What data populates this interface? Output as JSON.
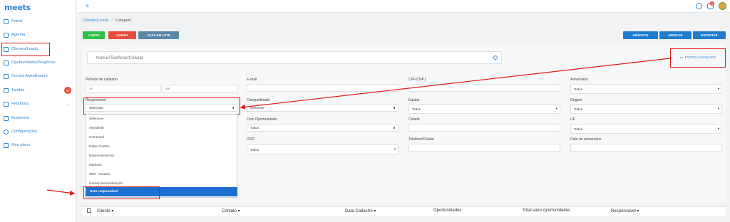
{
  "app": {
    "logo": "meets"
  },
  "sidebar": {
    "items": [
      {
        "label": "Painel"
      },
      {
        "label": "Agenda"
      },
      {
        "label": "Clientes/Leads"
      },
      {
        "label": "Oportunidades/Negócios"
      },
      {
        "label": "Central Atendimento"
      },
      {
        "label": "Tarefas",
        "badge": "47"
      },
      {
        "label": "Relatórios"
      },
      {
        "label": "Academia"
      },
      {
        "label": "Configurações"
      },
      {
        "label": "Meu plano"
      }
    ]
  },
  "topbar": {
    "notif_count": "5"
  },
  "breadcrumb": {
    "parent": "Clientes/Leads",
    "current": "Listagem"
  },
  "toolbar": {
    "novo": "+ NOVO",
    "lixeira": "LIXEIRA",
    "acao_lote": "AÇÃO EM LOTE",
    "graficos": "GRÁFICOS",
    "unificar": "UNIFICAR",
    "exportar": "EXPORTAR"
  },
  "search": {
    "placeholder": "Nome/Telefone/Celular"
  },
  "filtro_avancado": "FILTRO AVANÇADO",
  "filters": {
    "periodo_cadastro": {
      "label": "Período de cadastro",
      "de": "de",
      "ate": "até"
    },
    "responsavel": {
      "label": "Responsável",
      "value": "Selecione"
    },
    "email": {
      "label": "E-mail"
    },
    "compartilhado": {
      "label": "Compartilhado",
      "value": "Selecione"
    },
    "com_oportunidade": {
      "label": "Com Oportunidade",
      "value": "Todos"
    },
    "ddd": {
      "label": "DDD",
      "value": "Todos"
    },
    "cpf_cnpj": {
      "label": "CPF/CNPJ"
    },
    "equipe": {
      "label": "Equipe",
      "value": "Todos"
    },
    "cidade": {
      "label": "Cidade"
    },
    "telefone": {
      "label": "Telefone/Celular"
    },
    "aniversario": {
      "label": "Aniversário",
      "value": "Todos"
    },
    "origem": {
      "label": "Origem",
      "value": "Todos"
    },
    "uf": {
      "label": "UF",
      "value": "Todos"
    },
    "data_aniversario": {
      "label": "Data de aniversário"
    }
  },
  "responsavel_dropdown": {
    "options": [
      "Selecione",
      "Atendente",
      "Comercial",
      "Dalivo Coelho",
      "Desenvolvimento",
      "Matheus",
      "SDR - Usuário",
      "Usuário Demonstração"
    ],
    "selected": "Sem responsável"
  },
  "table": {
    "columns": [
      "Cliente",
      "Contato",
      "Data Cadastro",
      "Oportunidades",
      "Total valor oportunidades",
      "Responsável"
    ]
  },
  "colors": {
    "accent": "#2e86d4",
    "green": "#2ec24a",
    "red": "#e74c3c",
    "grey": "#5b87a8",
    "annotation": "#e01818"
  }
}
